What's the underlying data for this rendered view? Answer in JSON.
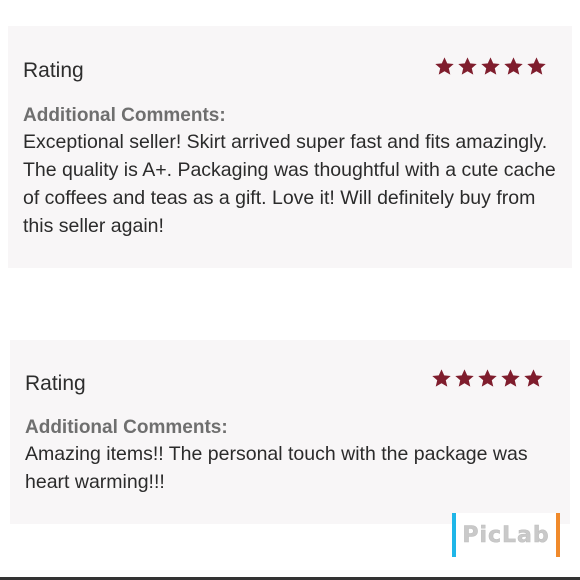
{
  "reviews": [
    {
      "rating_label": "Rating",
      "stars": 5,
      "comments_heading": "Additional Comments:",
      "comment": "Exceptional seller! Skirt arrived super fast and fits amazingly. The quality is A+. Packaging was thoughtful with a cute cache of coffees and teas as a gift. Love it! Will definitely buy from this seller again!"
    },
    {
      "rating_label": "Rating",
      "stars": 5,
      "comments_heading": "Additional Comments:",
      "comment": "Amazing items!! The personal touch with the package was heart warming!!!"
    }
  ],
  "star_icon": "star-icon",
  "colors": {
    "star": "#7f1d2d",
    "card_background": "#f8f6f7",
    "watermark_left": "#1fb6e8",
    "watermark_right": "#f08a2b"
  },
  "watermark": {
    "text": "PicLab"
  }
}
